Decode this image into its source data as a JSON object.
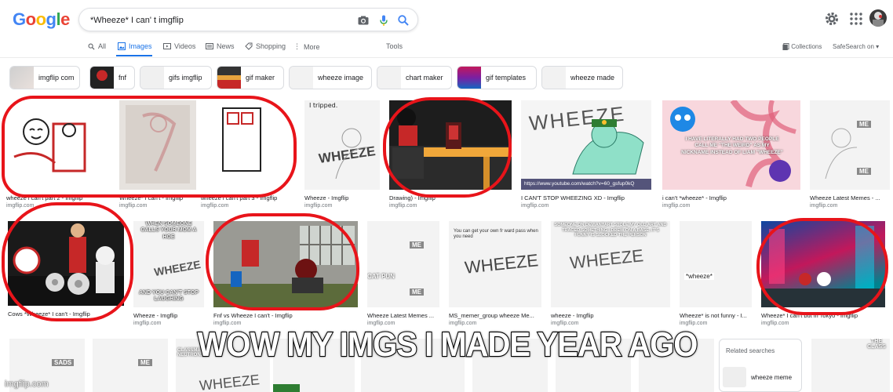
{
  "google_logo": [
    "G",
    "o",
    "o",
    "g",
    "l",
    "e"
  ],
  "colors": {
    "blue": "#4285F4",
    "red": "#EA4335",
    "yellow": "#FBBC05",
    "green": "#34A853",
    "accent": "#1a73e8",
    "circle": "#e8141a"
  },
  "search": {
    "query": "*Wheeze* I can' t imgflip"
  },
  "icons": {
    "camera": "camera-icon",
    "mic": "mic-icon",
    "search": "search-icon",
    "gear": "gear-icon",
    "apps": "apps-grid-icon"
  },
  "tabs": [
    {
      "label": "All",
      "icon": "search-icon"
    },
    {
      "label": "Images",
      "icon": "image-icon",
      "active": true
    },
    {
      "label": "Videos",
      "icon": "video-icon"
    },
    {
      "label": "News",
      "icon": "news-icon"
    },
    {
      "label": "Shopping",
      "icon": "tag-icon"
    },
    {
      "label": "More",
      "icon": "more-icon"
    },
    {
      "label": "Tools"
    }
  ],
  "tabs_right": {
    "collections": "Collections",
    "safesearch": "SafeSearch on"
  },
  "chips": [
    "imgflip com",
    "fnf",
    "gifs imgflip",
    "gif maker",
    "wheeze image",
    "chart maker",
    "gif templates",
    "wheeze made"
  ],
  "row1": [
    {
      "caption": "wheeze i can't part 2 - Imgflip",
      "source": "imgflip.com"
    },
    {
      "caption": "Wheeze* I can't - Imgflip",
      "source": "imgflip.com"
    },
    {
      "caption": "wheeze i can't part 3 - Imgflip",
      "source": "imgflip.com"
    },
    {
      "caption": "Wheeze - Imgflip",
      "source": "imgflip.com",
      "text_top": "I tripped.",
      "text_mid": "WHEEZE"
    },
    {
      "caption": "Drawing) - Imgflip",
      "source": "imgflip.com"
    },
    {
      "caption": "I CAN'T STOP WHEEZING XD - Imgflip",
      "source": "imgflip.com",
      "text_top": "WHEEZE",
      "text_bottom": "https://www.youtube.com/watch?v=60_gsfup0kQ"
    },
    {
      "caption": "i can't *wheeze* - Imgflip",
      "source": "imgflip.com",
      "text_mid": "I HAVE LITERALLY HAD TWO PEOPLE CALL ME \"THE WEIRD\" AS MY NICKNAME INSTEAD OF LIAM \"WHEEZE\""
    },
    {
      "caption": "Wheeze Latest Memes - ...",
      "source": "imgflip.com",
      "text_top": "ME",
      "text_mid": "ME"
    }
  ],
  "row2": [
    {
      "caption": "Cows *Wheeze* I can't - Imgflip",
      "source": "imgflip.com"
    },
    {
      "caption": "Wheeze - Imgflip",
      "source": "imgflip.com",
      "text_top": "WHEN SOMEONE CALLS YOUR MOM A HOE",
      "text_mid": "WHEEZE",
      "text_bottom": "AND YOU CAN'T STOP LAUGHING"
    },
    {
      "caption": "Fnf vs Wheeze I can't - Imgflip",
      "source": "imgflip.com"
    },
    {
      "caption": "Wheeze Latest Memes ...",
      "source": "imgflip.com",
      "text_top": "ME",
      "text_mid": "CAT PUN",
      "text_bottom": "ME"
    },
    {
      "caption": "MS_memer_group wheeze Me...",
      "source": "imgflip.com",
      "text_top": "You can get your own fr ward pass when you need",
      "text_mid": "WHEEZE"
    },
    {
      "caption": "wheeze - Imgflip",
      "source": "imgflip.com",
      "text_top": "SOMEONE ON DEVIANTART STOLE MY OLD ART AND TRACED SOMETHING I DREW ON A BASE, IT'S FUNNY IS SLOCKED THE PERSON",
      "text_mid": "WHEEZE"
    },
    {
      "caption": "Wheeze* is not funny - I...",
      "source": "imgflip.com",
      "text_mid": "*wheeze*"
    },
    {
      "caption": "Wheeze* I can't but in Tokyo - Imgflip",
      "source": "imgflip.com"
    }
  ],
  "row3_labels": [
    "SADS",
    "ME",
    "CLASSMATES NEUTRON...",
    "WHEEZE",
    "THE CLASS"
  ],
  "related": {
    "title": "Related searches",
    "item": "wheeze meme"
  },
  "watermark": "imgflip.com",
  "overlay_caption": "WOW MY IMGS I MADE YEAR AGO"
}
